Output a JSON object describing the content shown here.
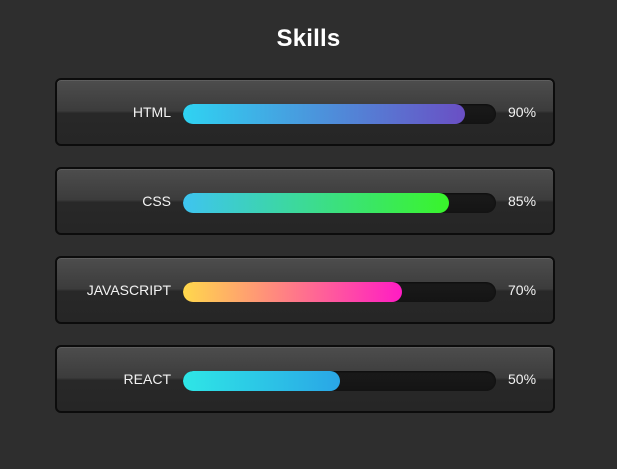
{
  "title": "Skills",
  "skills": [
    {
      "label": "HTML",
      "percent_text": "90%",
      "level": 0.9,
      "gradient": [
        "#2fd3f2",
        "#6a4fc4"
      ]
    },
    {
      "label": "CSS",
      "percent_text": "85%",
      "level": 0.85,
      "gradient": [
        "#3ec4f0",
        "#39f52a"
      ]
    },
    {
      "label": "JAVASCRIPT",
      "percent_text": "70%",
      "level": 0.7,
      "gradient": [
        "#ffd84c",
        "#ff1cc4"
      ]
    },
    {
      "label": "REACT",
      "percent_text": "50%",
      "level": 0.5,
      "gradient": [
        "#2ee6e6",
        "#2aa6e6"
      ]
    }
  ]
}
